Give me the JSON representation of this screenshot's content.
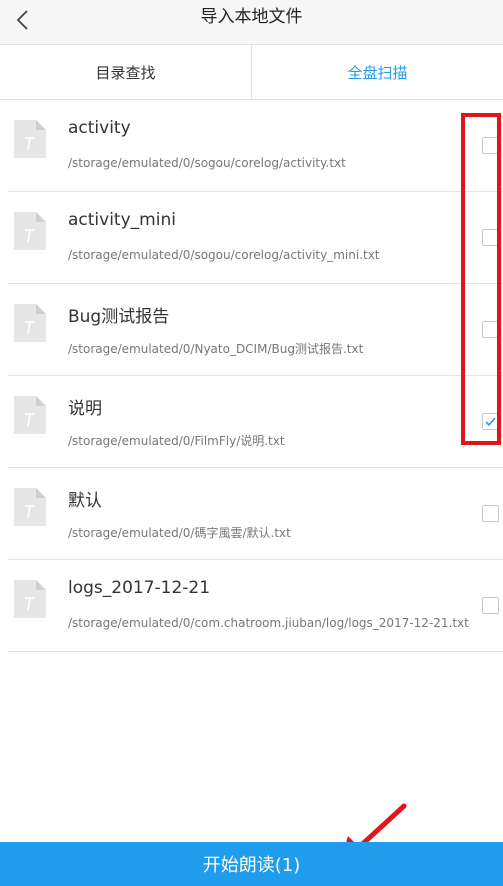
{
  "header": {
    "title": "导入本地文件"
  },
  "tabs": [
    {
      "label": "目录查找",
      "active": false
    },
    {
      "label": "全盘扫描",
      "active": true
    }
  ],
  "files": [
    {
      "name": "activity",
      "path": "/storage/emulated/0/sogou/corelog/activity.txt",
      "checked": false
    },
    {
      "name": "activity_mini",
      "path": "/storage/emulated/0/sogou/corelog/activity_mini.txt",
      "checked": false
    },
    {
      "name": "Bug测试报告",
      "path": "/storage/emulated/0/Nyato_DCIM/Bug测试报告.txt",
      "checked": false
    },
    {
      "name": "说明",
      "path": "/storage/emulated/0/FilmFly/说明.txt",
      "checked": true
    },
    {
      "name": "默认",
      "path": "/storage/emulated/0/碼字風雲/默认.txt",
      "checked": false
    },
    {
      "name": "logs_2017-12-21",
      "path": "/storage/emulated/0/com.chatroom.jiuban/log/logs_2017-12-21.txt",
      "checked": false
    }
  ],
  "bottom": {
    "label": "开始朗读(1)"
  },
  "colors": {
    "accent": "#1f9cee",
    "annotation": "#e0161b"
  },
  "icons": {
    "back": "back-chevron-icon",
    "file": "text-file-icon",
    "check": "checkmark-icon",
    "annotation_arrow": "red-arrow-icon"
  }
}
